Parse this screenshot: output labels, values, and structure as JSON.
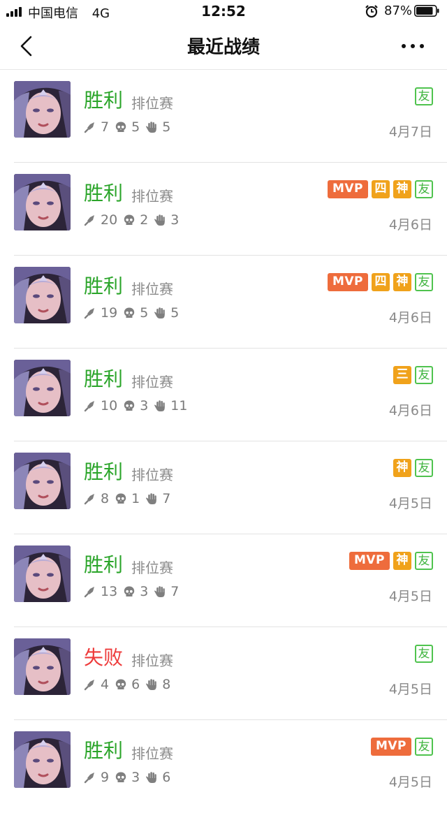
{
  "status_bar": {
    "carrier": "中国电信",
    "network": "4G",
    "time": "12:52",
    "battery": "87%"
  },
  "nav": {
    "title": "最近战绩"
  },
  "colors": {
    "win": "#2ba52a",
    "lose": "#ee3b3b",
    "mvp_badge": "#ee6c3c",
    "gold_badge": "#f0a21b",
    "friend_badge": "#4fc34e"
  },
  "icons": {
    "kills": "sword-icon",
    "deaths": "skull-icon",
    "assists": "hand-icon"
  },
  "matches": [
    {
      "result": "胜利",
      "outcome": "win",
      "mode": "排位赛",
      "kills": "7",
      "deaths": "5",
      "assists": "5",
      "date": "4月7日",
      "badges": [
        "友"
      ]
    },
    {
      "result": "胜利",
      "outcome": "win",
      "mode": "排位赛",
      "kills": "20",
      "deaths": "2",
      "assists": "3",
      "date": "4月6日",
      "badges": [
        "MVP",
        "四",
        "神",
        "友"
      ]
    },
    {
      "result": "胜利",
      "outcome": "win",
      "mode": "排位赛",
      "kills": "19",
      "deaths": "5",
      "assists": "5",
      "date": "4月6日",
      "badges": [
        "MVP",
        "四",
        "神",
        "友"
      ]
    },
    {
      "result": "胜利",
      "outcome": "win",
      "mode": "排位赛",
      "kills": "10",
      "deaths": "3",
      "assists": "11",
      "date": "4月6日",
      "badges": [
        "三",
        "友"
      ]
    },
    {
      "result": "胜利",
      "outcome": "win",
      "mode": "排位赛",
      "kills": "8",
      "deaths": "1",
      "assists": "7",
      "date": "4月5日",
      "badges": [
        "神",
        "友"
      ]
    },
    {
      "result": "胜利",
      "outcome": "win",
      "mode": "排位赛",
      "kills": "13",
      "deaths": "3",
      "assists": "7",
      "date": "4月5日",
      "badges": [
        "MVP",
        "神",
        "友"
      ]
    },
    {
      "result": "失败",
      "outcome": "lose",
      "mode": "排位赛",
      "kills": "4",
      "deaths": "6",
      "assists": "8",
      "date": "4月5日",
      "badges": [
        "友"
      ]
    },
    {
      "result": "胜利",
      "outcome": "win",
      "mode": "排位赛",
      "kills": "9",
      "deaths": "3",
      "assists": "6",
      "date": "4月5日",
      "badges": [
        "MVP",
        "友"
      ]
    }
  ]
}
